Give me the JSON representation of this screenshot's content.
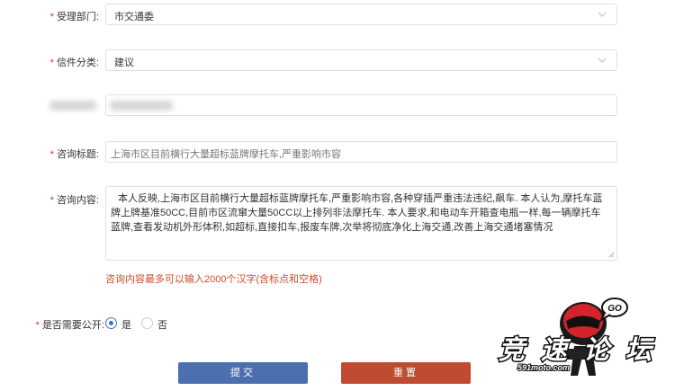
{
  "form": {
    "department": {
      "label": "受理部门:",
      "value": "市交通委"
    },
    "category": {
      "label": "信件分类:",
      "value": "建议"
    },
    "title_field": {
      "label": "咨询标题:",
      "value": "上海市区目前横行大量超标蓝牌摩托车,严重影响市容"
    },
    "content_field": {
      "label": "咨询内容:",
      "value": "本人反映,上海市区目前横行大量超标蓝牌摩托车,严重影响市容,各种穿插严重违法违纪,飙车. 本人认为,摩托车蓝牌上牌基准50CC,目前市区流窜大量50CC以上排列非法摩托车. 本人要求,和电动车开箱查电瓶一样,每一辆摩托车蓝牌,查看发动机外形体积,如超标,直接扣车,报废车牌,次举将彻底净化上海交通,改善上海交通堵塞情况",
      "hint": "咨询内容最多可以输入2000个汉字(含标点和空格)"
    },
    "public": {
      "label": "是否需要公开:",
      "options": [
        "是",
        "否"
      ],
      "selected": "是"
    },
    "required_mark": "*",
    "submit_label": "提交",
    "reset_label": "重置"
  },
  "watermark": {
    "text": "竞速论坛",
    "url": "591moto.com",
    "bubble": "GO"
  },
  "colors": {
    "required": "#d9351c",
    "hint": "#d14b2a",
    "submit": "#4c6fb0",
    "reset": "#be4b32",
    "radio": "#3b6fd4"
  }
}
